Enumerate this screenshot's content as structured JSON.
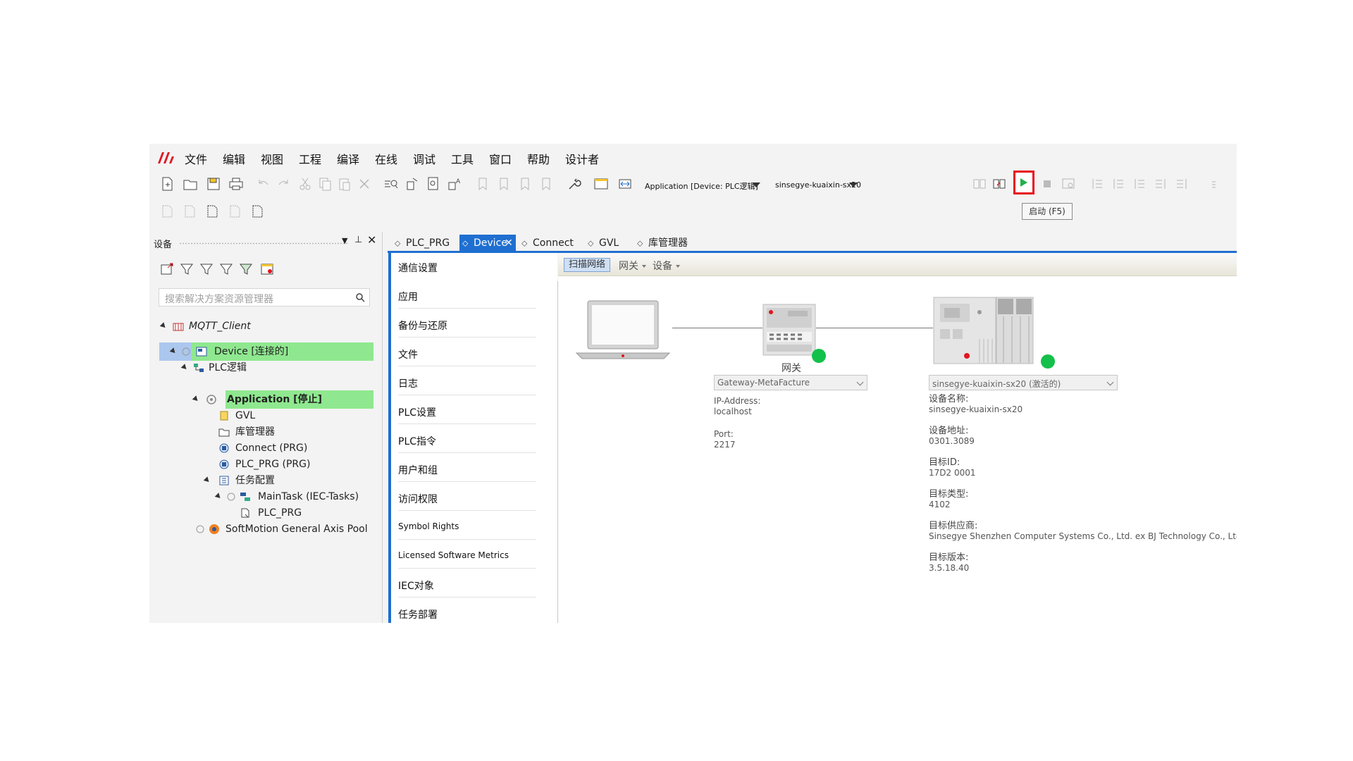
{
  "menu": {
    "items": [
      "文件",
      "编辑",
      "视图",
      "工程",
      "编译",
      "在线",
      "调试",
      "工具",
      "窗口",
      "帮助",
      "设计者"
    ]
  },
  "toolbar": {
    "application_combo": "Application [Device: PLC逻辑]",
    "device_combo": "sinsegye-kuaixin-sx20",
    "start_tooltip": "启动 (F5)"
  },
  "devices_panel": {
    "title": "设备",
    "search_placeholder": "搜索解决方案资源管理器",
    "tree": [
      {
        "label": "MQTT_Client",
        "icon": "project-icon"
      },
      {
        "label": "Device [连接的]",
        "icon": "device-icon",
        "highlight": "blue"
      },
      {
        "label": "PLC逻辑",
        "icon": "plc-logic-icon"
      },
      {
        "label": "Application [停止]",
        "icon": "application-icon",
        "highlight": "green"
      },
      {
        "label": "GVL",
        "icon": "gvl-icon"
      },
      {
        "label": "库管理器",
        "icon": "library-icon"
      },
      {
        "label": "Connect (PRG)",
        "icon": "program-icon"
      },
      {
        "label": "PLC_PRG (PRG)",
        "icon": "program-icon"
      },
      {
        "label": "任务配置",
        "icon": "task-config-icon"
      },
      {
        "label": "MainTask (IEC-Tasks)",
        "icon": "task-icon"
      },
      {
        "label": "PLC_PRG",
        "icon": "pou-call-icon"
      },
      {
        "label": "SoftMotion General Axis Pool",
        "icon": "axis-pool-icon"
      }
    ],
    "green_highlight_color": "#8fe88f",
    "blue_highlight_color": "#abc7ee"
  },
  "editor": {
    "tabs": [
      "PLC_PRG",
      "Device",
      "Connect",
      "GVL",
      "库管理器"
    ],
    "active_tab": "Device",
    "accent_color": "#1f6fd1",
    "nav_items": [
      "通信设置",
      "应用",
      "备份与还原",
      "文件",
      "日志",
      "PLC设置",
      "PLC指令",
      "用户和组",
      "访问权限",
      "Symbol Rights",
      "Licensed Software Metrics",
      "IEC对象",
      "任务部署"
    ],
    "subbar": {
      "scan": "扫描网络",
      "gateway": "网关",
      "device": "设备"
    },
    "gateway": {
      "label": "网关",
      "combo": "Gateway-MetaFacture",
      "ip_label": "IP-Address:",
      "ip_value": "localhost",
      "port_label": "Port:",
      "port_value": "2217"
    },
    "device": {
      "combo": "sinsegye-kuaixin-sx20 (激活的)",
      "name_label": "设备名称:",
      "name_value": "sinsegye-kuaixin-sx20",
      "addr_label": "设备地址:",
      "addr_value": "0301.3089",
      "target_id_label": "目标ID:",
      "target_id_value": "17D2 0001",
      "target_type_label": "目标类型:",
      "target_type_value": "4102",
      "vendor_label": "目标供应商:",
      "vendor_value": "Sinsegye Shenzhen Computer Systems Co., Ltd. ex BJ Technology Co., Ltd.",
      "version_label": "目标版本:",
      "version_value": "3.5.18.40"
    },
    "status_color": "#13c04a"
  }
}
